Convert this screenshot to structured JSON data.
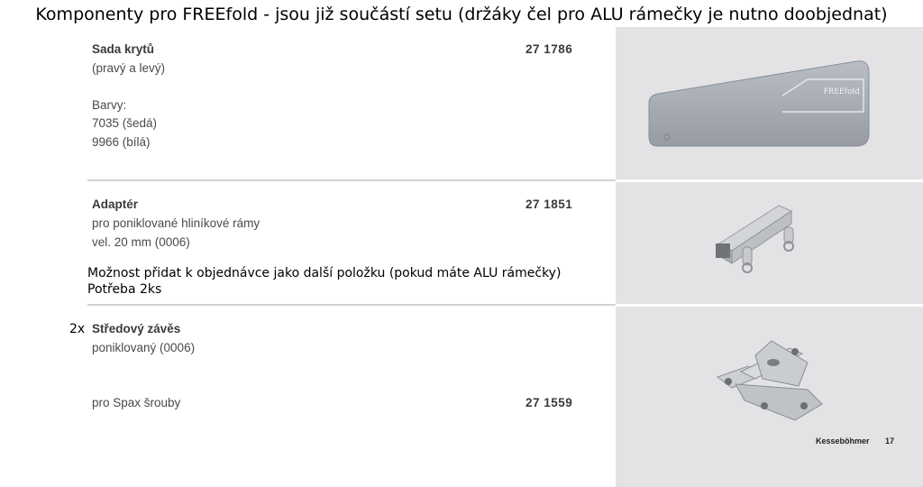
{
  "page_heading": "Komponenty pro FREEfold - jsou již součástí setu (držáky čel pro ALU rámečky je nutno doobjednat)",
  "items": [
    {
      "name": "Sada krytů",
      "subtitle": "(pravý a levý)",
      "code": "27 1786",
      "colors_label": "Barvy:",
      "colors": [
        "7035 (šedá)",
        "9966 (bílá)"
      ],
      "image_text": "FREEfold",
      "image_icon": "cover-cap-icon"
    },
    {
      "name": "Adaptér",
      "desc1": "pro poniklované hliníkové rámy",
      "desc2": "vel. 20 mm (0006)",
      "code": "27 1851",
      "note_line1": "Možnost přidat k objednávce jako další položku (pokud máte ALU rámečky)",
      "note_line2": "Potřeba 2ks",
      "image_icon": "adapter-bracket-icon"
    },
    {
      "quantity": "2x",
      "name": "Středový závěs",
      "desc1": "poniklovaný (0006)",
      "variant": "pro Spax šrouby",
      "code": "27 1559",
      "image_icon": "center-hinge-icon"
    }
  ],
  "footer": {
    "brand": "Kesseböhmer",
    "page_number": "17"
  },
  "colors": {
    "photo_background": "#e3e3e5",
    "rule": "#cfd2d6",
    "part_grey": "#a6abb3",
    "nickel": "#c4c6c9"
  }
}
